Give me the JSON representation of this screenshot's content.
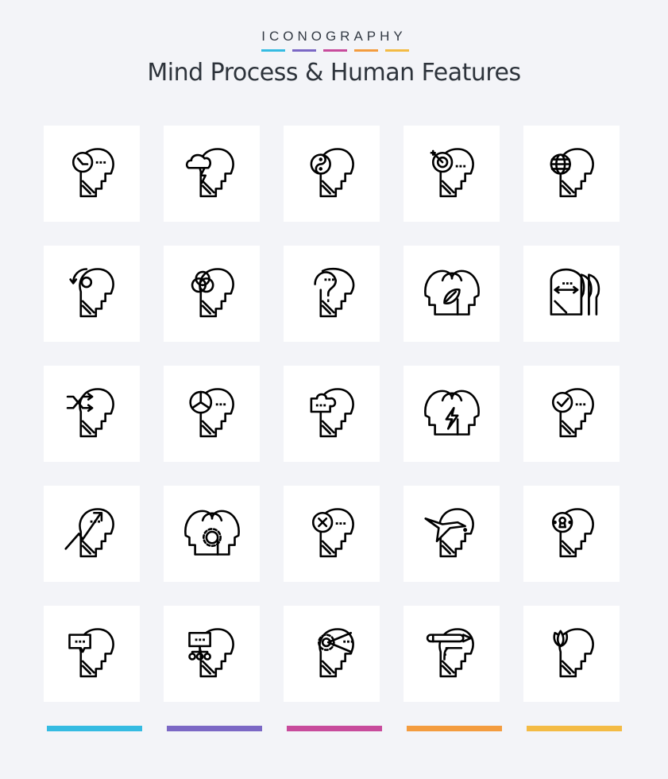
{
  "header": {
    "brand": "ICONOGRAPHY",
    "title": "Mind Process & Human Features",
    "brand_colors": [
      "#35bbe2",
      "#7b68c5",
      "#c84b9c",
      "#f39c3f",
      "#f3bb45"
    ]
  },
  "icons": [
    {
      "name": "mind-time-icon"
    },
    {
      "name": "mind-storm-icon"
    },
    {
      "name": "mind-yin-yang-icon"
    },
    {
      "name": "mind-target-icon"
    },
    {
      "name": "mind-globe-icon"
    },
    {
      "name": "mind-refresh-icon"
    },
    {
      "name": "mind-venn-icon"
    },
    {
      "name": "mind-question-icon"
    },
    {
      "name": "two-heads-leaf-icon"
    },
    {
      "name": "three-heads-exchange-icon"
    },
    {
      "name": "mind-shuffle-icon"
    },
    {
      "name": "mind-pie-chart-icon"
    },
    {
      "name": "mind-puzzle-icon"
    },
    {
      "name": "two-heads-bolt-icon"
    },
    {
      "name": "mind-check-icon"
    },
    {
      "name": "mind-growth-icon"
    },
    {
      "name": "two-heads-gear-icon"
    },
    {
      "name": "mind-cancel-icon"
    },
    {
      "name": "mind-bird-icon"
    },
    {
      "name": "mind-keyhole-icon"
    },
    {
      "name": "mind-chat-icon"
    },
    {
      "name": "mind-hierarchy-icon"
    },
    {
      "name": "mind-gear-vision-icon"
    },
    {
      "name": "mind-pen-icon"
    },
    {
      "name": "mind-lotus-icon"
    }
  ],
  "footer": {
    "bar_colors": [
      "#35bbe2",
      "#7b68c5",
      "#c84b9c",
      "#f39c3f",
      "#f3bb45"
    ]
  }
}
